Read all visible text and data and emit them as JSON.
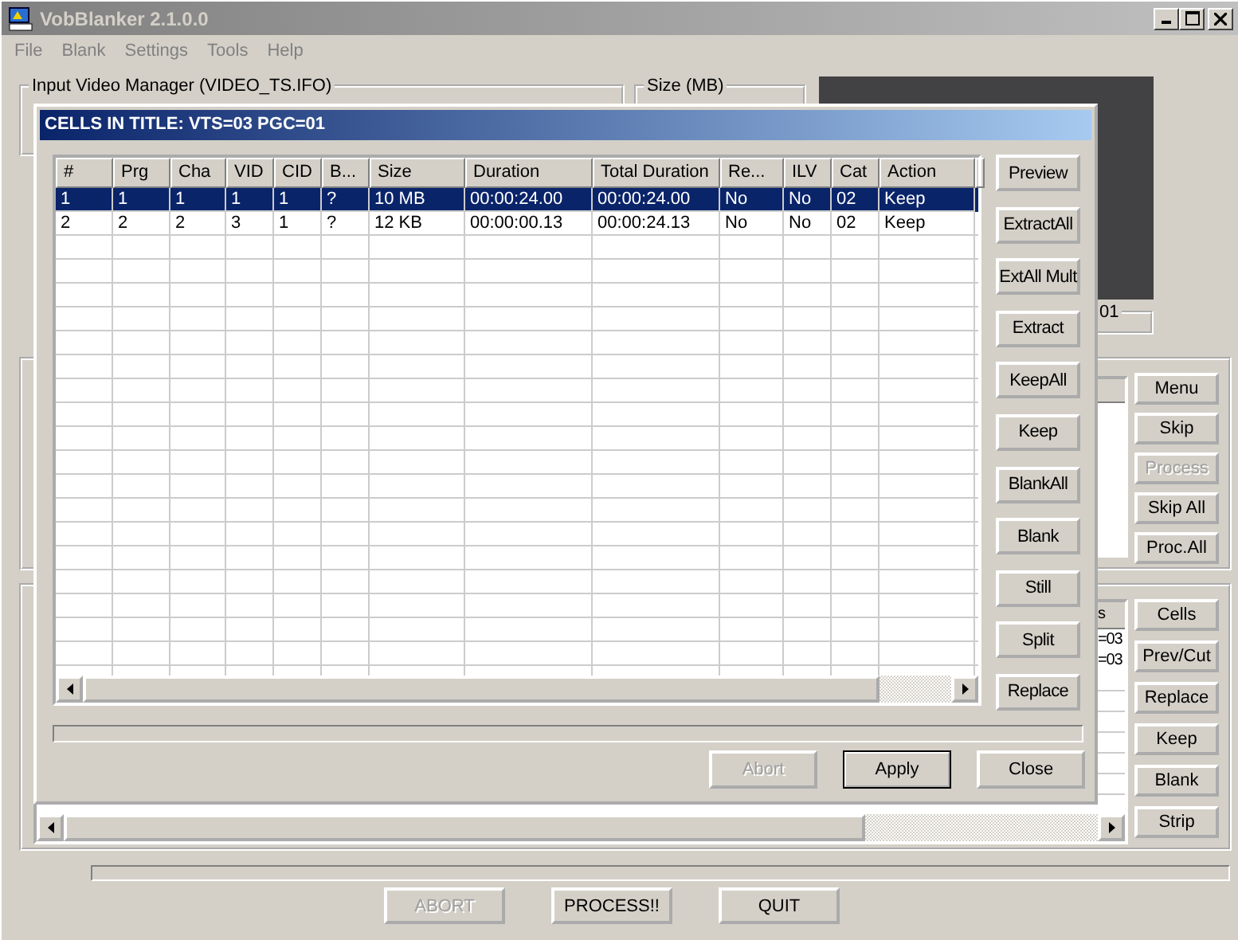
{
  "window": {
    "title": "VobBlanker 2.1.0.0"
  },
  "menu": [
    "File",
    "Blank",
    "Settings",
    "Tools",
    "Help"
  ],
  "main": {
    "input_group": {
      "label": "Input Video Manager (VIDEO_TS.IFO)"
    },
    "size_group": {
      "label": "Size (MB)"
    },
    "partial_group": {
      "label": "01"
    },
    "title_buttons": [
      {
        "label": "Menu",
        "disabled": false
      },
      {
        "label": "Skip",
        "disabled": false
      },
      {
        "label": "Process",
        "disabled": true
      },
      {
        "label": "Skip All",
        "disabled": false
      },
      {
        "label": "Proc.All",
        "disabled": false
      }
    ],
    "cell_list": {
      "column_header": "s",
      "cells": [
        "=03",
        "=03"
      ]
    },
    "cell_buttons": [
      {
        "label": "Cells",
        "disabled": false
      },
      {
        "label": "Prev/Cut",
        "disabled": false
      },
      {
        "label": "Replace",
        "disabled": false
      },
      {
        "label": "Keep",
        "disabled": false
      },
      {
        "label": "Blank",
        "disabled": false
      },
      {
        "label": "Strip",
        "disabled": false
      }
    ],
    "bottom_buttons": [
      {
        "label": "ABORT",
        "disabled": true
      },
      {
        "label": "PROCESS!!",
        "disabled": false
      },
      {
        "label": "QUIT",
        "disabled": false
      }
    ],
    "progress": {
      "level": 0
    }
  },
  "dialog": {
    "title": "CELLS IN TITLE: VTS=03 PGC=01",
    "columns": [
      "#",
      "Prg",
      "Cha",
      "VID",
      "CID",
      "B...",
      "Size",
      "Duration",
      "Total Duration",
      "Re...",
      "ILV",
      "Cat",
      "Action"
    ],
    "rows": [
      {
        "selected": true,
        "cells": [
          "1",
          "1",
          "1",
          "1",
          "1",
          "?",
          "10 MB",
          "00:00:24.00",
          "00:00:24.00",
          "No",
          "No",
          "02",
          "Keep"
        ]
      },
      {
        "selected": false,
        "cells": [
          "2",
          "2",
          "2",
          "3",
          "1",
          "?",
          "12 KB",
          "00:00:00.13",
          "00:00:24.13",
          "No",
          "No",
          "02",
          "Keep"
        ]
      }
    ],
    "side_buttons": [
      {
        "label": "Preview",
        "disabled": false
      },
      {
        "label": "ExtractAll",
        "disabled": false
      },
      {
        "label": "ExtAll Mult",
        "disabled": false
      },
      {
        "label": "Extract",
        "disabled": false
      },
      {
        "label": "KeepAll",
        "disabled": false
      },
      {
        "label": "Keep",
        "disabled": false
      },
      {
        "label": "BlankAll",
        "disabled": false
      },
      {
        "label": "Blank",
        "disabled": false
      },
      {
        "label": "Still",
        "disabled": false
      },
      {
        "label": "Split",
        "disabled": false
      },
      {
        "label": "Replace",
        "disabled": false
      }
    ],
    "footer_buttons": [
      {
        "label": "Abort",
        "disabled": true,
        "default": false
      },
      {
        "label": "Apply",
        "disabled": false,
        "default": true
      },
      {
        "label": "Close",
        "disabled": false,
        "default": false
      }
    ],
    "progress": {
      "level": 0
    }
  }
}
